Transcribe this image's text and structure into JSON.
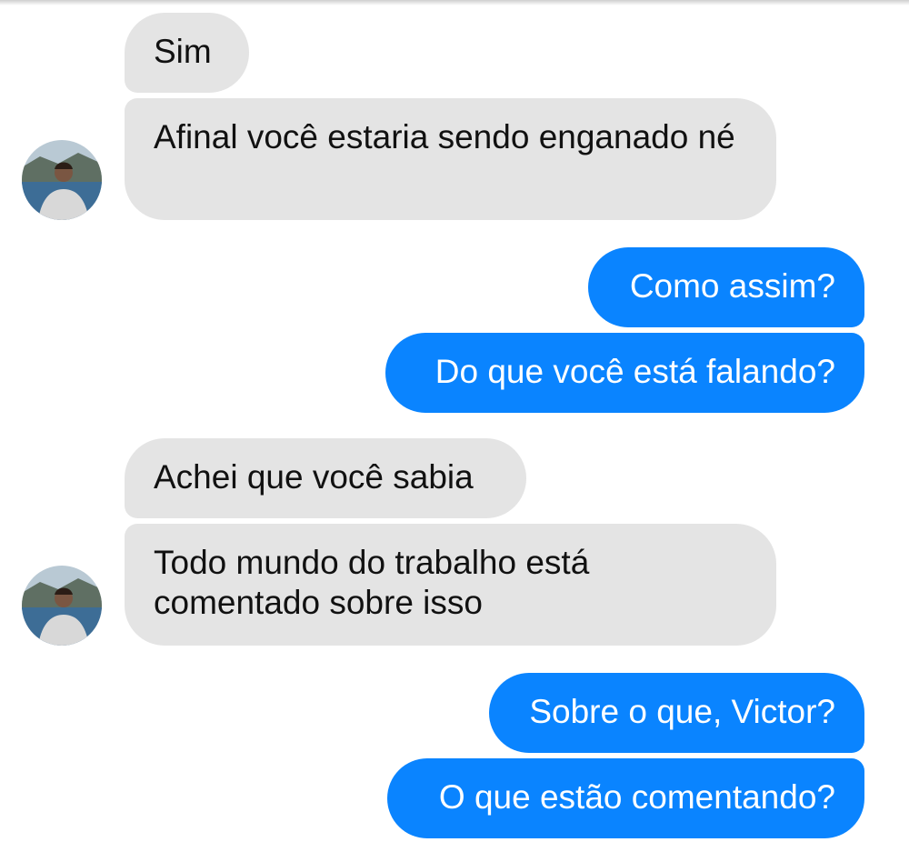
{
  "thread": {
    "messages": [
      {
        "sender": "contact",
        "text": "Sim"
      },
      {
        "sender": "contact",
        "text": "Afinal você estaria sendo enganado né"
      },
      {
        "sender": "me",
        "text": "Como assim?"
      },
      {
        "sender": "me",
        "text": "Do que você está falando?"
      },
      {
        "sender": "contact",
        "text": "Achei que você sabia"
      },
      {
        "sender": "contact",
        "text": "Todo mundo do trabalho está comentado sobre isso"
      },
      {
        "sender": "me",
        "text": "Sobre o que, Victor?"
      },
      {
        "sender": "me",
        "text": "O que estão comentando?"
      }
    ]
  },
  "colors": {
    "incoming_bubble": "#e4e4e4",
    "outgoing_bubble": "#0a84ff",
    "outgoing_text": "#ffffff",
    "incoming_text": "#111111"
  },
  "avatar": {
    "icon": "contact-avatar-photo"
  }
}
